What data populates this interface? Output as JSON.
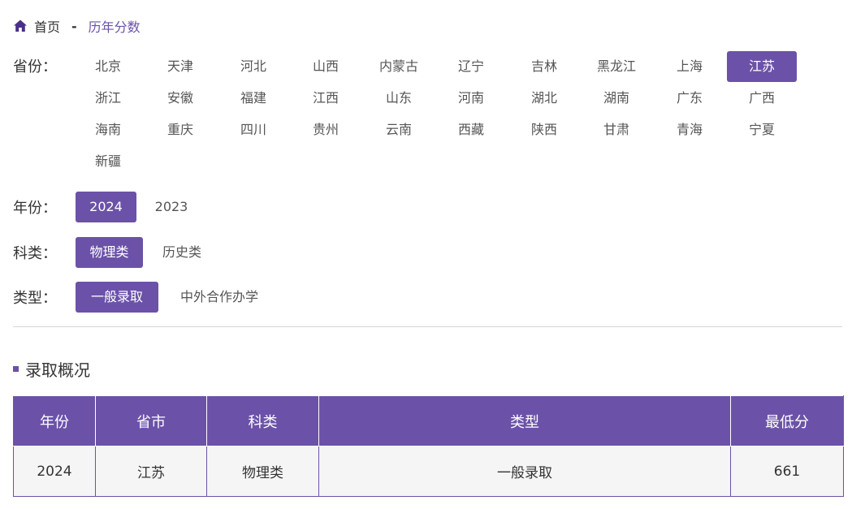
{
  "breadcrumb": {
    "home": "首页",
    "separator": "-",
    "current": "历年分数"
  },
  "filters": {
    "province": {
      "label": "省份：",
      "options": [
        "北京",
        "天津",
        "河北",
        "山西",
        "内蒙古",
        "辽宁",
        "吉林",
        "黑龙江",
        "上海",
        "江苏",
        "浙江",
        "安徽",
        "福建",
        "江西",
        "山东",
        "河南",
        "湖北",
        "湖南",
        "广东",
        "广西",
        "海南",
        "重庆",
        "四川",
        "贵州",
        "云南",
        "西藏",
        "陕西",
        "甘肃",
        "青海",
        "宁夏",
        "新疆"
      ],
      "selected": "江苏"
    },
    "year": {
      "label": "年份：",
      "options": [
        "2024",
        "2023"
      ],
      "selected": "2024"
    },
    "subject": {
      "label": "科类：",
      "options": [
        "物理类",
        "历史类"
      ],
      "selected": "物理类"
    },
    "type": {
      "label": "类型：",
      "options": [
        "一般录取",
        "中外合作办学"
      ],
      "selected": "一般录取"
    }
  },
  "section": {
    "title": "录取概况"
  },
  "table": {
    "headers": [
      "年份",
      "省市",
      "科类",
      "类型",
      "最低分"
    ],
    "rows": [
      [
        "2024",
        "江苏",
        "物理类",
        "一般录取",
        "661"
      ]
    ]
  },
  "colors": {
    "accent": "#6b52a8"
  }
}
